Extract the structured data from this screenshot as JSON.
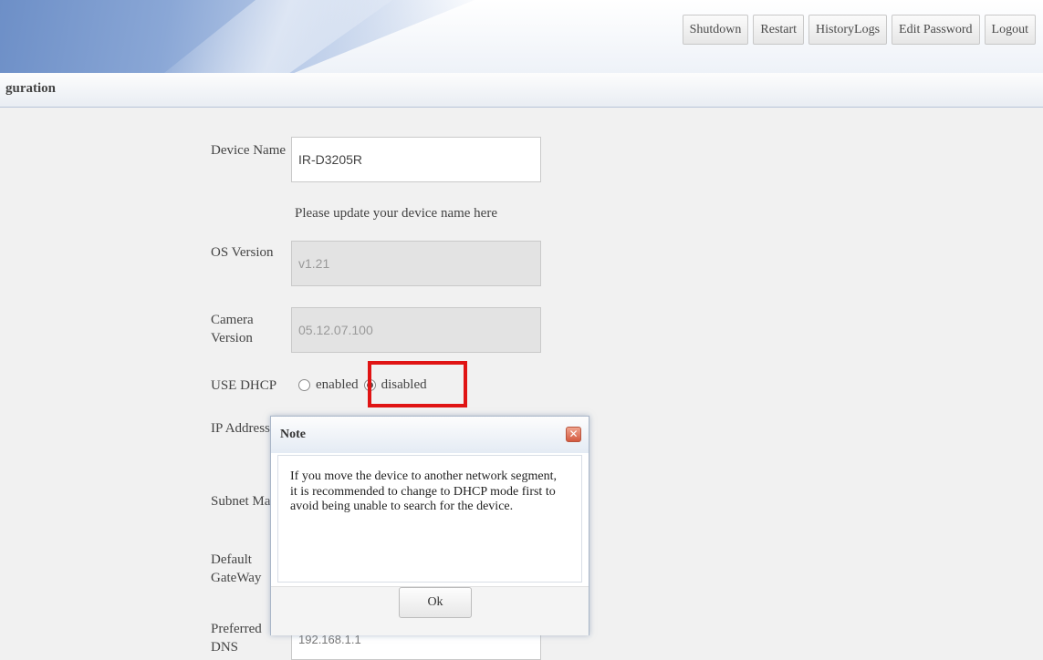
{
  "header": {
    "buttons": [
      "Shutdown",
      "Restart",
      "HistoryLogs",
      "Edit Password",
      "Logout"
    ]
  },
  "title_bar": {
    "title": "guration"
  },
  "form": {
    "device_name": {
      "label": "Device Name",
      "value": "IR-D3205R",
      "hint": "Please update your device name here"
    },
    "os_version": {
      "label": "OS Version",
      "value": "v1.21"
    },
    "camera_version": {
      "label_line1": "Camera",
      "label_line2": "Version",
      "value": "05.12.07.100"
    },
    "use_dhcp": {
      "label": "USE DHCP",
      "option_enabled": "enabled",
      "option_disabled": "disabled",
      "selected": "disabled"
    },
    "ip_address": {
      "label": "IP Address"
    },
    "subnet_mask": {
      "label": "Subnet Ma"
    },
    "default_gateway": {
      "label_line1": "Default",
      "label_line2": "GateWay"
    },
    "preferred_dns": {
      "label_line1": "Preferred",
      "label_line2": "DNS",
      "value": "192.168.1.1"
    }
  },
  "modal": {
    "title": "Note",
    "message": "If you move the device to another network segment, it is recommended to change to DHCP mode first to avoid being unable to search for the device.",
    "ok_label": "Ok"
  },
  "colors": {
    "highlight": "#e01414",
    "header_blue": "#6d8fc7"
  },
  "icons": {
    "close": "close-icon"
  }
}
